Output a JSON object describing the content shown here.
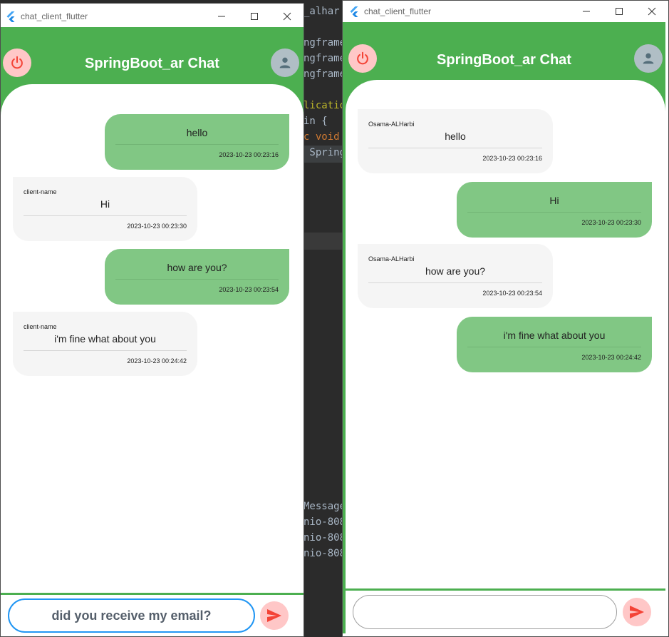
{
  "ide": {
    "lines": [
      {
        "text": "_alhar"
      },
      {
        "text": "ngframe"
      },
      {
        "text": "ngframe"
      },
      {
        "text": "ngframe"
      },
      {
        "text": "lication"
      },
      {
        "text": "in {"
      },
      {
        "text": "c void"
      },
      {
        "text": " Spring"
      },
      {
        "text": "Message"
      },
      {
        "text": "nio-808"
      },
      {
        "text": "nio-808"
      },
      {
        "text": "nio-808"
      }
    ]
  },
  "left_window": {
    "title": "chat_client_flutter",
    "app_title": "SpringBoot_ar Chat",
    "messages": [
      {
        "direction": "out",
        "sender": "",
        "text": "hello",
        "time": "2023-10-23 00:23:16"
      },
      {
        "direction": "in",
        "sender": "client-name",
        "text": "Hi",
        "time": "2023-10-23 00:23:30"
      },
      {
        "direction": "out",
        "sender": "",
        "text": "how are you?",
        "time": "2023-10-23 00:23:54"
      },
      {
        "direction": "in",
        "sender": "client-name",
        "text": "i'm fine what about you",
        "time": "2023-10-23 00:24:42"
      }
    ],
    "input_value": "did you receive my email?",
    "input_border_color": "#2196f3"
  },
  "right_window": {
    "title": "chat_client_flutter",
    "app_title": "SpringBoot_ar Chat",
    "messages": [
      {
        "direction": "in",
        "sender": "Osama-ALHarbi",
        "text": "hello",
        "time": "2023-10-23 00:23:16"
      },
      {
        "direction": "out",
        "sender": "",
        "text": "Hi",
        "time": "2023-10-23 00:23:30"
      },
      {
        "direction": "in",
        "sender": "Osama-ALHarbi",
        "text": "how are you?",
        "time": "2023-10-23 00:23:54"
      },
      {
        "direction": "out",
        "sender": "",
        "text": "i'm fine what about you",
        "time": "2023-10-23 00:24:42"
      }
    ],
    "input_value": "",
    "input_border_color": "#9e9e9e"
  },
  "colors": {
    "primary": "#4caf50",
    "bubble_out": "#81c784",
    "bubble_in": "#f5f5f5",
    "power_bg": "#ffc7c7",
    "power_icon": "#f44336",
    "avatar_bg": "#b0bec5",
    "send_icon": "#f44336"
  },
  "icons": {
    "power": "power-icon",
    "avatar": "person-icon",
    "send": "send-icon",
    "logo": "flutter-logo-icon"
  }
}
